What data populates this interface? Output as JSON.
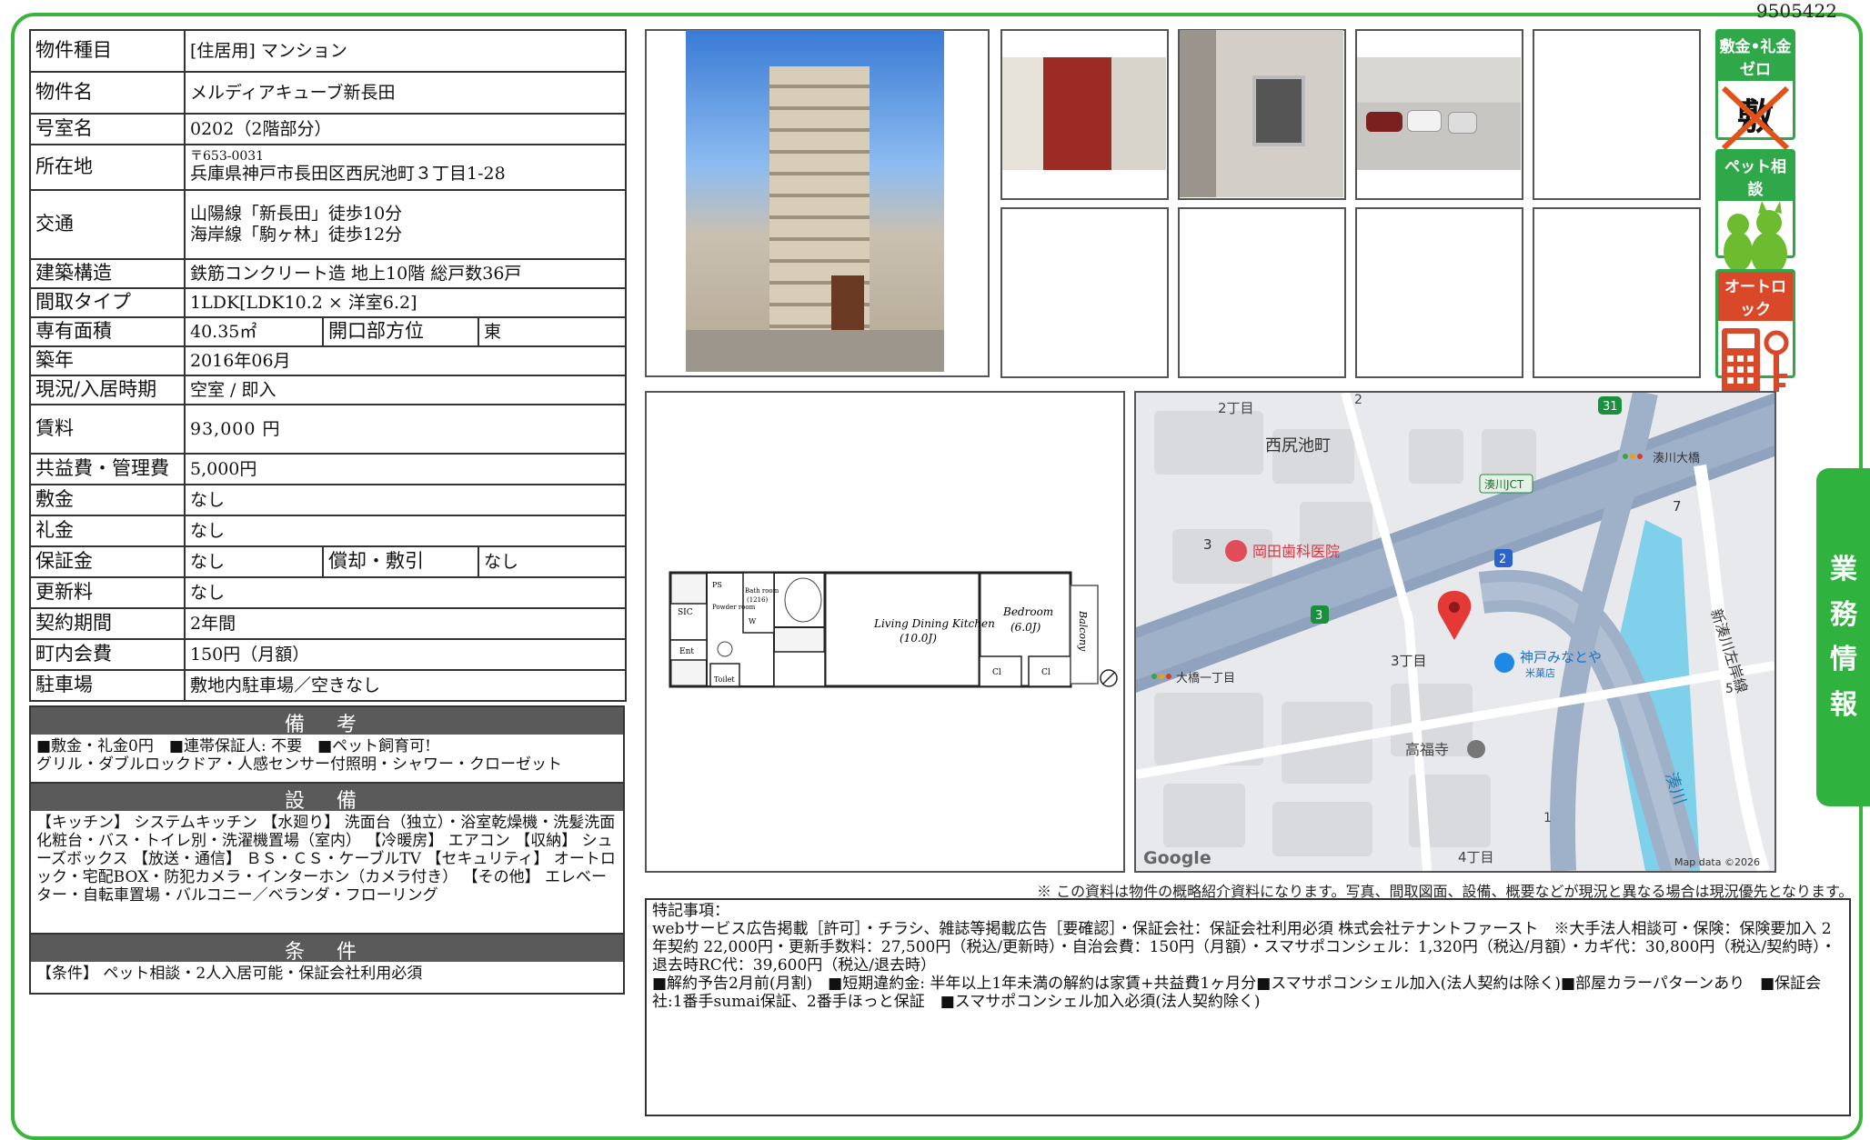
{
  "doc_id": "9505422",
  "spec": {
    "type_label": "物件種目",
    "type_value": "[住居用] マンション",
    "name_label": "物件名",
    "name_value": "メルディアキューブ新長田",
    "room_label": "号室名",
    "room_value": "0202（2階部分）",
    "addr_label": "所在地",
    "zip": "〒653-0031",
    "addr_value": "兵庫県神戸市長田区西尻池町３丁目1-28",
    "access_label": "交通",
    "access_1": "山陽線「新長田」徒歩10分",
    "access_2": "海岸線「駒ヶ林」徒歩12分",
    "struct_label": "建築構造",
    "struct_value": "鉄筋コンクリート造 地上10階 総戸数36戸",
    "layout_label": "間取タイプ",
    "layout_value": "1LDK[LDK10.2 × 洋室6.2]",
    "area_label": "専有面積",
    "area_value": "40.35㎡",
    "dir_label": "開口部方位",
    "dir_value": "東",
    "built_label": "築年",
    "built_value": "2016年06月",
    "status_label": "現況/入居時期",
    "status_value": "空室 / 即入",
    "rent_label": "賃料",
    "rent_value": "93,000 円",
    "fee_label": "共益費・管理費",
    "fee_value": "5,000円",
    "deposit_label": "敷金",
    "deposit_value": "なし",
    "key_label": "礼金",
    "key_value": "なし",
    "guarantee_label": "保証金",
    "guarantee_value": "なし",
    "amort_label": "償却・敷引",
    "amort_value": "なし",
    "renew_label": "更新料",
    "renew_value": "なし",
    "term_label": "契約期間",
    "term_value": "2年間",
    "town_label": "町内会費",
    "town_value": "150円（月額）",
    "parking_label": "駐車場",
    "parking_value": "敷地内駐車場／空きなし"
  },
  "remarks": {
    "title": "備 考",
    "line1": "■敷金・礼金0円　■連帯保証人: 不要　■ペット飼育可!",
    "line2": "グリル・ダブルロックドア・人感センサー付照明・シャワー・クローゼット"
  },
  "equipment": {
    "title": "設 備",
    "text": "【キッチン】 システムキッチン 【水廻り】 洗面台（独立）・浴室乾燥機・洗髪洗面化粧台・バス・トイレ別・洗濯機置場（室内） 【冷暖房】 エアコン 【収納】 シューズボックス 【放送・通信】 ＢＳ・ＣＳ・ケーブルTV 【セキュリティ】 オートロック・宅配BOX・防犯カメラ・インターホン（カメラ付き） 【その他】 エレベーター・自転車置場・バルコニー／ベランダ・フローリング"
  },
  "conditions": {
    "title": "条 件",
    "text": "【条件】 ペット相談・2人入居可能・保証会社利用必須"
  },
  "badges": {
    "b1": "敷金•礼金ゼロ",
    "b1_mark": "敷 礼",
    "b2": "ペット相談",
    "b3": "オートロック"
  },
  "side_tab": [
    "業",
    "務",
    "情",
    "報"
  ],
  "floorplan": {
    "ldk": "Living Dining Kitchen",
    "ldk_size": "(10.0J)",
    "bed": "Bedroom",
    "bed_size": "(6.0J)",
    "balcony": "Balcony",
    "bath": "Bath room",
    "bath2": "(1216)",
    "powder": "Powder room",
    "toilet": "Toilet",
    "ent": "Ent",
    "sic": "SIC",
    "ps": "PS",
    "wf": "W",
    "cl": "Cl",
    "cl2": "Cl"
  },
  "map": {
    "chome2": "2丁目",
    "num2": "2",
    "nishijiri": "西尻池町",
    "r31": "31",
    "minatogawa": "湊川大橋",
    "jct": "湊川JCT",
    "num7": "7",
    "num3a": "3",
    "dental": "岡田歯科医院",
    "r2": "2",
    "r3": "3",
    "ohashi": "大橋一丁目",
    "chome3": "3丁目",
    "kobe": "神戸みなとや",
    "kobe2": "米菓店",
    "shinminato": "新湊川左岸線",
    "num5": "5",
    "kofuku": "高福寺",
    "minato_river": "湊川",
    "num1": "1",
    "chome4": "4丁目",
    "google": "Google",
    "mapdata": "Map data ©2026"
  },
  "note": "※ この資料は物件の概略紹介資料になります。写真、間取図面、設備、概要などが現況と異なる場合は現況優先となります。",
  "special": {
    "title": "特記事項：",
    "line1": "webサービス広告掲載［許可］・チラシ、雑誌等掲載広告［要確認］・保証会社：保証会社利用必須 株式会社テナントファースト　※大手法人相談可・保険：保険要加入 2年契約 22,000円・更新手数料：27,500円（税込/更新時）・自治会費：150円（月額）・スマサポコンシェル：1,320円（税込/月額）・カギ代：30,800円（税込/契約時）・退去時RC代：39,600円（税込/退去時）",
    "line2": "■解約予告2月前(月割)　■短期違約金: 半年以上1年未満の解約は家賃+共益費1ヶ月分■スマサポコンシェル加入(法人契約は除く)■部屋カラーパターンあり　■保証会社:1番手sumai保証、2番手ほっと保証　■スマサポコンシェル加入必須(法人契約除く)"
  }
}
